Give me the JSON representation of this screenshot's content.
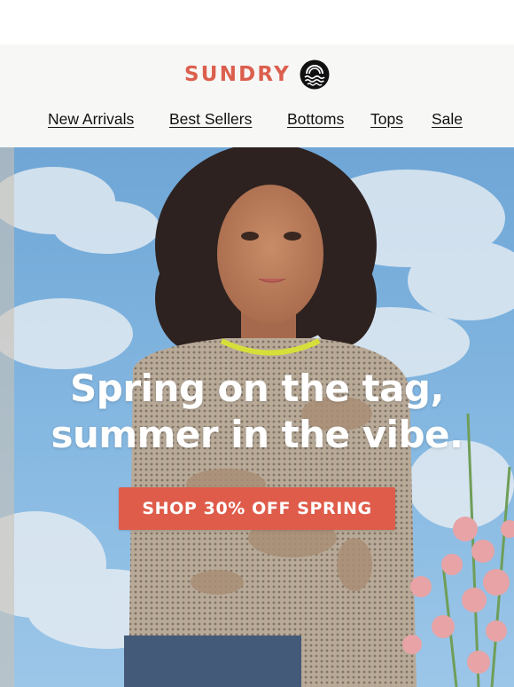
{
  "header": {
    "brand": "SUNDRY",
    "logo_icon": "sun-waves-icon",
    "nav": [
      {
        "label": "New Arrivals"
      },
      {
        "label": "Best Sellers"
      },
      {
        "label": "Bottoms"
      },
      {
        "label": "Tops"
      },
      {
        "label": "Sale"
      }
    ]
  },
  "hero": {
    "headline_line1": "Spring on the tag,",
    "headline_line2": "summer in the vibe.",
    "cta_label": "SHOP 30% OFF SPRING"
  },
  "colors": {
    "brand": "#dc5f4e",
    "cta_background": "#df5c4b",
    "header_background": "#f7f7f5",
    "sky": "#7fb0dc"
  }
}
